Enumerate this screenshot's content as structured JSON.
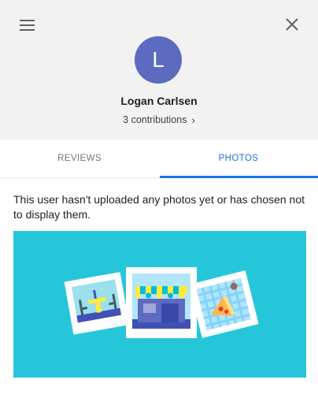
{
  "header": {
    "menu_icon": "hamburger-menu-icon",
    "close_icon": "close-icon",
    "avatar_letter": "L",
    "avatar_color": "#5c6bc0",
    "user_name": "Logan Carlsen",
    "contributions_label": "3 contributions",
    "contributions_chevron": "›"
  },
  "tabs": [
    {
      "label": "REVIEWS",
      "selected": false
    },
    {
      "label": "PHOTOS",
      "selected": true
    }
  ],
  "main": {
    "empty_message": "This user hasn't uploaded any photos yet or has chosen not to display them.",
    "illustration_background": "#26c6da"
  },
  "colors": {
    "header_background": "#f2f2f2",
    "accent": "#1a73e8",
    "tab_inactive": "#70757a"
  }
}
